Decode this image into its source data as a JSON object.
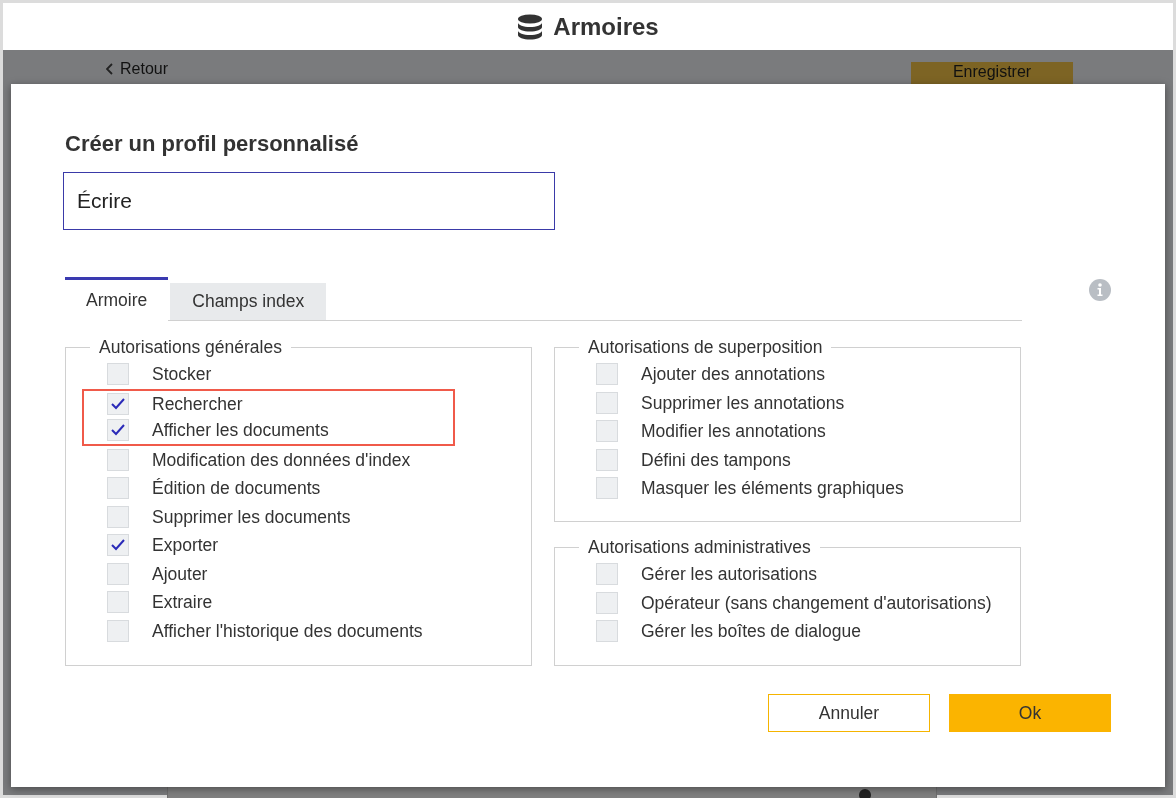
{
  "header": {
    "title": "Armoires"
  },
  "background": {
    "back_link": "Retour",
    "save_button": "Enregistrer"
  },
  "dialog": {
    "title": "Créer un profil personnalisé",
    "name_field": {
      "value": "Écrire"
    },
    "tabs": [
      {
        "label": "Armoire",
        "selected": true
      },
      {
        "label": "Champs index",
        "selected": false
      }
    ],
    "groups": [
      {
        "title": "Autorisations générales",
        "items": [
          {
            "label": "Stocker",
            "checked": false,
            "highlighted": false
          },
          {
            "label": "Rechercher",
            "checked": true,
            "highlighted": true
          },
          {
            "label": "Afficher les documents",
            "checked": true,
            "highlighted": true
          },
          {
            "label": "Modification des données d'index",
            "checked": false,
            "highlighted": false
          },
          {
            "label": "Édition de documents",
            "checked": false,
            "highlighted": false
          },
          {
            "label": "Supprimer les documents",
            "checked": false,
            "highlighted": false
          },
          {
            "label": "Exporter",
            "checked": true,
            "highlighted": false
          },
          {
            "label": "Ajouter",
            "checked": false,
            "highlighted": false
          },
          {
            "label": "Extraire",
            "checked": false,
            "highlighted": false
          },
          {
            "label": "Afficher l'historique des documents",
            "checked": false,
            "highlighted": false
          }
        ]
      },
      {
        "title": "Autorisations de superposition",
        "items": [
          {
            "label": "Ajouter des annotations",
            "checked": false,
            "highlighted": false
          },
          {
            "label": "Supprimer les annotations",
            "checked": false,
            "highlighted": false
          },
          {
            "label": "Modifier les annotations",
            "checked": false,
            "highlighted": false
          },
          {
            "label": "Défini des tampons",
            "checked": false,
            "highlighted": false
          },
          {
            "label": "Masquer les éléments graphiques",
            "checked": false,
            "highlighted": false
          }
        ]
      },
      {
        "title": "Autorisations administratives",
        "items": [
          {
            "label": "Gérer les autorisations",
            "checked": false,
            "highlighted": false
          },
          {
            "label": "Opérateur (sans changement d'autorisations)",
            "checked": false,
            "highlighted": false
          },
          {
            "label": "Gérer les boîtes de dialogue",
            "checked": false,
            "highlighted": false
          }
        ]
      }
    ],
    "buttons": [
      {
        "label": "Annuler",
        "kind": "secondary"
      },
      {
        "label": "Ok",
        "kind": "primary"
      }
    ]
  }
}
